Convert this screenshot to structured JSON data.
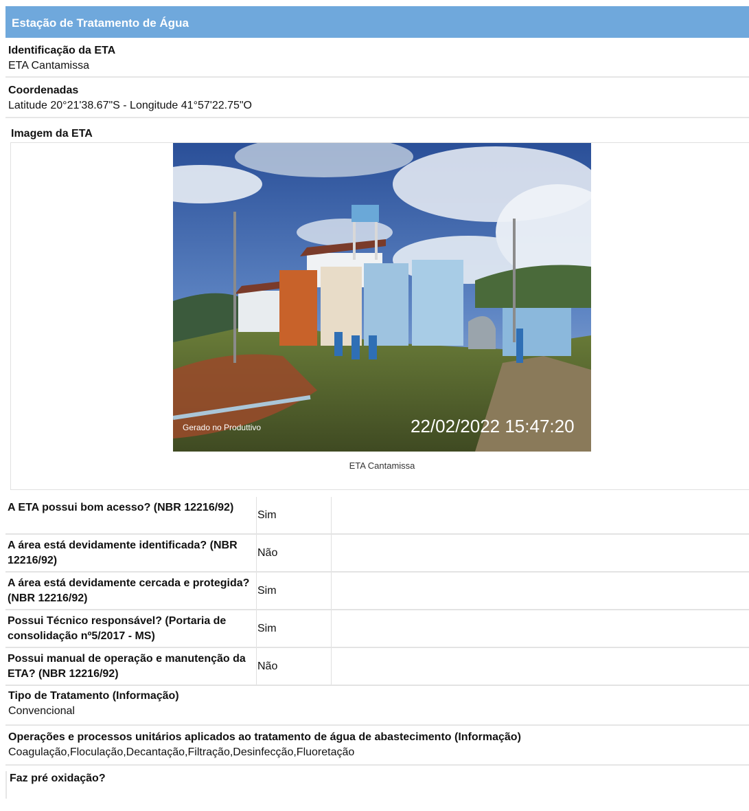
{
  "header": {
    "title": "Estação de Tratamento de Água"
  },
  "identificacao": {
    "label": "Identificação da ETA",
    "value": "ETA Cantamissa"
  },
  "coordenadas": {
    "label": "Coordenadas",
    "value": "Latitude 20°21'38.67\"S - Longitude 41°57'22.75\"O"
  },
  "imagem": {
    "label": "Imagem da ETA",
    "watermark": "Gerado no Produttivo",
    "timestamp": "22/02/2022 15:47:20",
    "caption": "ETA Cantamissa"
  },
  "questions": [
    {
      "q": "A ETA possui bom acesso? (NBR 12216/92)",
      "a": "Sim"
    },
    {
      "q": "A área está devidamente identificada? (NBR 12216/92)",
      "a": "Não"
    },
    {
      "q": "A área está devidamente cercada e protegida? (NBR 12216/92)",
      "a": "Sim"
    },
    {
      "q": "Possui Técnico responsável? (Portaria de consolidação nº5/2017 - MS)",
      "a": "Sim"
    },
    {
      "q": "Possui manual de operação e manutenção da ETA? (NBR 12216/92)",
      "a": "Não"
    }
  ],
  "tipo_tratamento": {
    "label": "Tipo de Tratamento (Informação)",
    "value": "Convencional"
  },
  "operacoes": {
    "label": "Operações e processos unitários aplicados ao tratamento de água de abastecimento (Informação)",
    "value": "Coagulação,Floculação,Decantação,Filtração,Desinfecção,Fluoretação"
  },
  "pre_oxidacao": {
    "label": "Faz pré oxidação?"
  }
}
